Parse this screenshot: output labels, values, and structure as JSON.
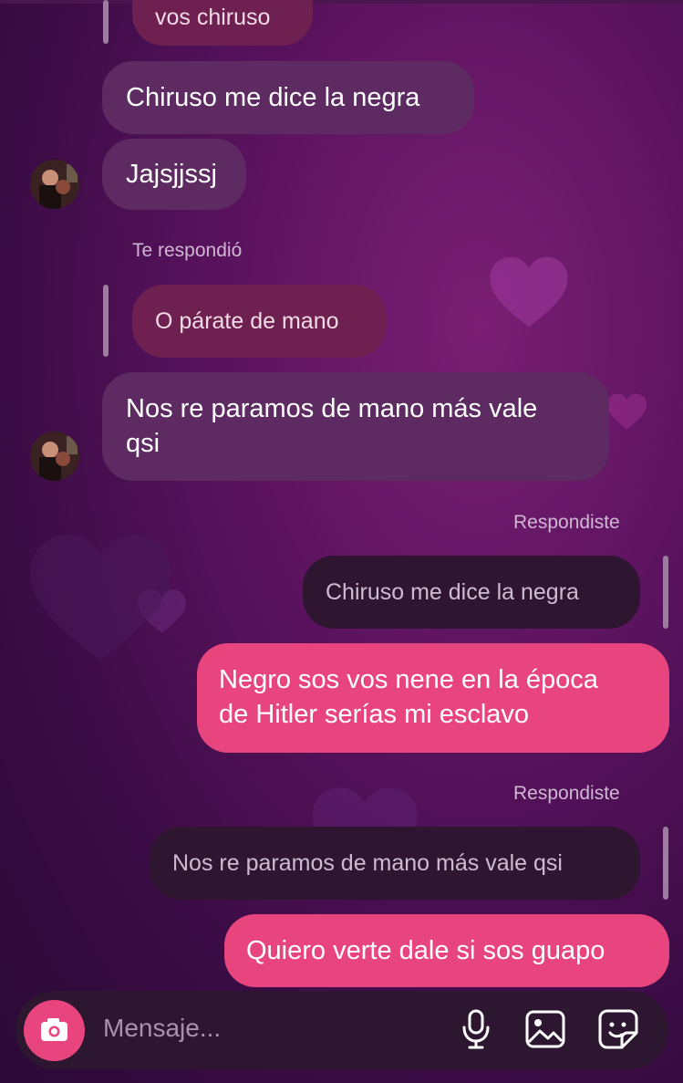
{
  "messages": {
    "partial_reply_in": "vos chiruso",
    "in_1": "Chiruso me dice la negra",
    "in_2": "Jajsjjssj",
    "reply_label_in": "Te respondió",
    "reply_quote_in": "O párate de mano",
    "in_3_line1": "Nos re paramos de mano más vale",
    "in_3_line2": "qsi",
    "reply_label_out_1": "Respondiste",
    "reply_quote_out_1": "Chiruso me dice la negra",
    "out_1_line1": "Negro sos vos nene en la época",
    "out_1_line2": "de Hitler serías mi esclavo",
    "reply_label_out_2": "Respondiste",
    "reply_quote_out_2": "Nos re paramos de mano más vale qsi",
    "out_2": "Quiero verte dale si sos guapo"
  },
  "composer": {
    "placeholder": "Mensaje...",
    "icons": [
      "camera-icon",
      "microphone-icon",
      "gallery-icon",
      "sticker-icon"
    ]
  },
  "colors": {
    "outgoing_bubble": "#e8457f",
    "incoming_bubble": "#5e2a62",
    "background": "#5c1360"
  }
}
